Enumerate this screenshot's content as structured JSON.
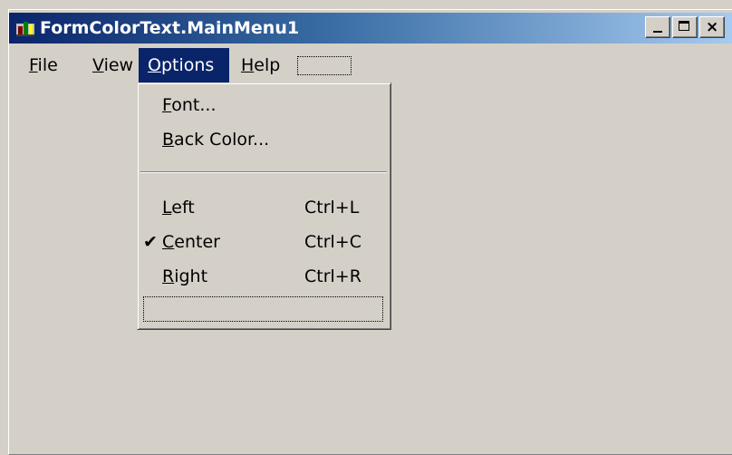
{
  "window": {
    "title": "FormColorText.MainMenu1"
  },
  "menubar": {
    "items": [
      {
        "label_ul": "F",
        "label_rest": "ile"
      },
      {
        "label_ul": "V",
        "label_rest": "iew"
      },
      {
        "label_ul": "O",
        "label_rest": "ptions"
      },
      {
        "label_ul": "H",
        "label_rest": "elp"
      }
    ]
  },
  "options_menu": {
    "font": {
      "ul": "F",
      "rest": "ont..."
    },
    "back_color": {
      "ul": "B",
      "rest": "ack Color..."
    },
    "left": {
      "ul": "L",
      "rest": "eft",
      "shortcut": "Ctrl+L"
    },
    "center": {
      "ul": "C",
      "rest": "enter",
      "shortcut": "Ctrl+C",
      "check": "✔"
    },
    "right": {
      "ul": "R",
      "rest": "ight",
      "shortcut": "Ctrl+R"
    }
  },
  "icons": {
    "app": "app-icon",
    "minimize": "minimize-icon",
    "maximize": "maximize-icon",
    "close": "close-icon",
    "close_glyph": "×"
  },
  "colors": {
    "title_gradient_start": "#0a246a",
    "title_gradient_end": "#a6caf0",
    "menu_highlight": "#0a246a",
    "face": "#d4d0c8"
  }
}
